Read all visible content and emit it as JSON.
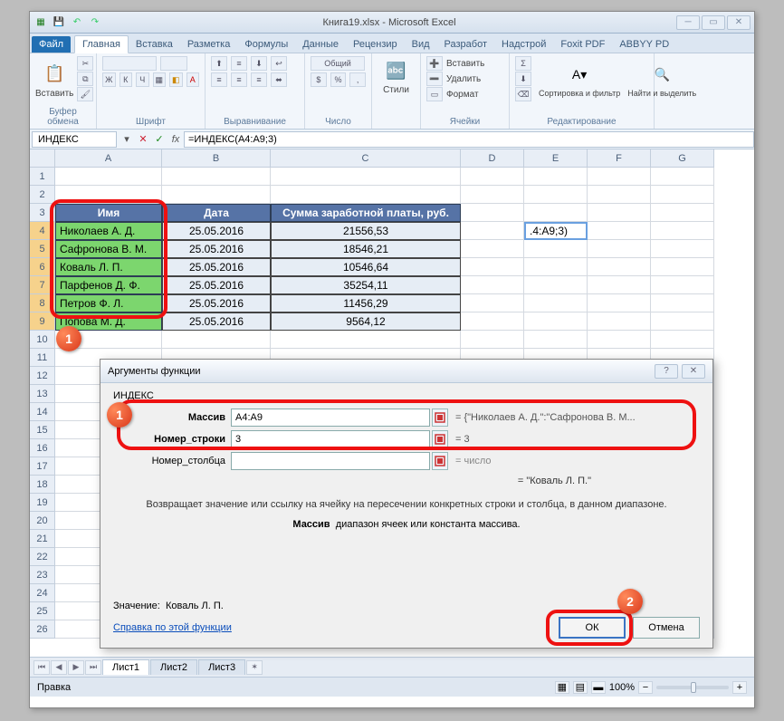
{
  "title": "Книга19.xlsx - Microsoft Excel",
  "tabs": {
    "file": "Файл",
    "home": "Главная",
    "insert": "Вставка",
    "layout": "Разметка",
    "formulas": "Формулы",
    "data": "Данные",
    "review": "Рецензир",
    "view": "Вид",
    "dev": "Разработ",
    "addins": "Надстрой",
    "foxit": "Foxit PDF",
    "abbyy": "ABBYY PD"
  },
  "ribbon": {
    "paste": "Вставить",
    "clipboard": "Буфер обмена",
    "font": "Шрифт",
    "align": "Выравнивание",
    "number": "Число",
    "numfmt": "Общий",
    "styles": "Стили",
    "cells": "Ячейки",
    "editing": "Редактирование",
    "insert_row": "Вставить",
    "delete_row": "Удалить",
    "format": "Формат",
    "sort": "Сортировка и фильтр",
    "find": "Найти и выделить",
    "sigma": "Σ"
  },
  "nameBox": "ИНДЕКС",
  "formula": "=ИНДЕКС(A4:A9;3)",
  "colHeaders": [
    "A",
    "B",
    "C",
    "D",
    "E",
    "F",
    "G"
  ],
  "rowHeaders": [
    "1",
    "2",
    "3",
    "4",
    "5",
    "6",
    "7",
    "8",
    "9",
    "10",
    "11",
    "12",
    "13",
    "14",
    "15",
    "16",
    "17",
    "18",
    "19",
    "20",
    "21",
    "22",
    "23",
    "24",
    "25",
    "26"
  ],
  "table": {
    "headers": {
      "name": "Имя",
      "date": "Дата",
      "sum": "Сумма заработной платы, руб."
    },
    "rows": [
      {
        "name": "Николаев А. Д.",
        "date": "25.05.2016",
        "sum": "21556,53"
      },
      {
        "name": "Сафронова В. М.",
        "date": "25.05.2016",
        "sum": "18546,21"
      },
      {
        "name": "Коваль Л. П.",
        "date": "25.05.2016",
        "sum": "10546,64"
      },
      {
        "name": "Парфенов Д. Ф.",
        "date": "25.05.2016",
        "sum": "35254,11"
      },
      {
        "name": "Петров Ф. Л.",
        "date": "25.05.2016",
        "sum": "11456,29"
      },
      {
        "name": "Попова М. Д.",
        "date": "25.05.2016",
        "sum": "9564,12"
      }
    ]
  },
  "activeCell": ".4:A9;3)",
  "sheets": {
    "s1": "Лист1",
    "s2": "Лист2",
    "s3": "Лист3"
  },
  "status": "Правка",
  "zoom": "100%",
  "dialog": {
    "title": "Аргументы функции",
    "fn": "ИНДЕКС",
    "args": {
      "array_lbl": "Массив",
      "array_val": "A4:A9",
      "array_res": "= {\"Николаев А. Д.\":\"Сафронова В. М...",
      "row_lbl": "Номер_строки",
      "row_val": "3",
      "row_res": "= 3",
      "col_lbl": "Номер_столбца",
      "col_val": "",
      "col_res": "= число"
    },
    "result": "= \"Коваль Л. П.\"",
    "desc": "Возвращает значение или ссылку на ячейку на пересечении конкретных строки и столбца, в данном диапазоне.",
    "subdesc_lbl": "Массив",
    "subdesc": "диапазон ячеек или константа массива.",
    "value_lbl": "Значение:",
    "value": "Коваль Л. П.",
    "help": "Справка по этой функции",
    "ok": "ОК",
    "cancel": "Отмена"
  },
  "callouts": {
    "one": "1",
    "two": "2"
  }
}
